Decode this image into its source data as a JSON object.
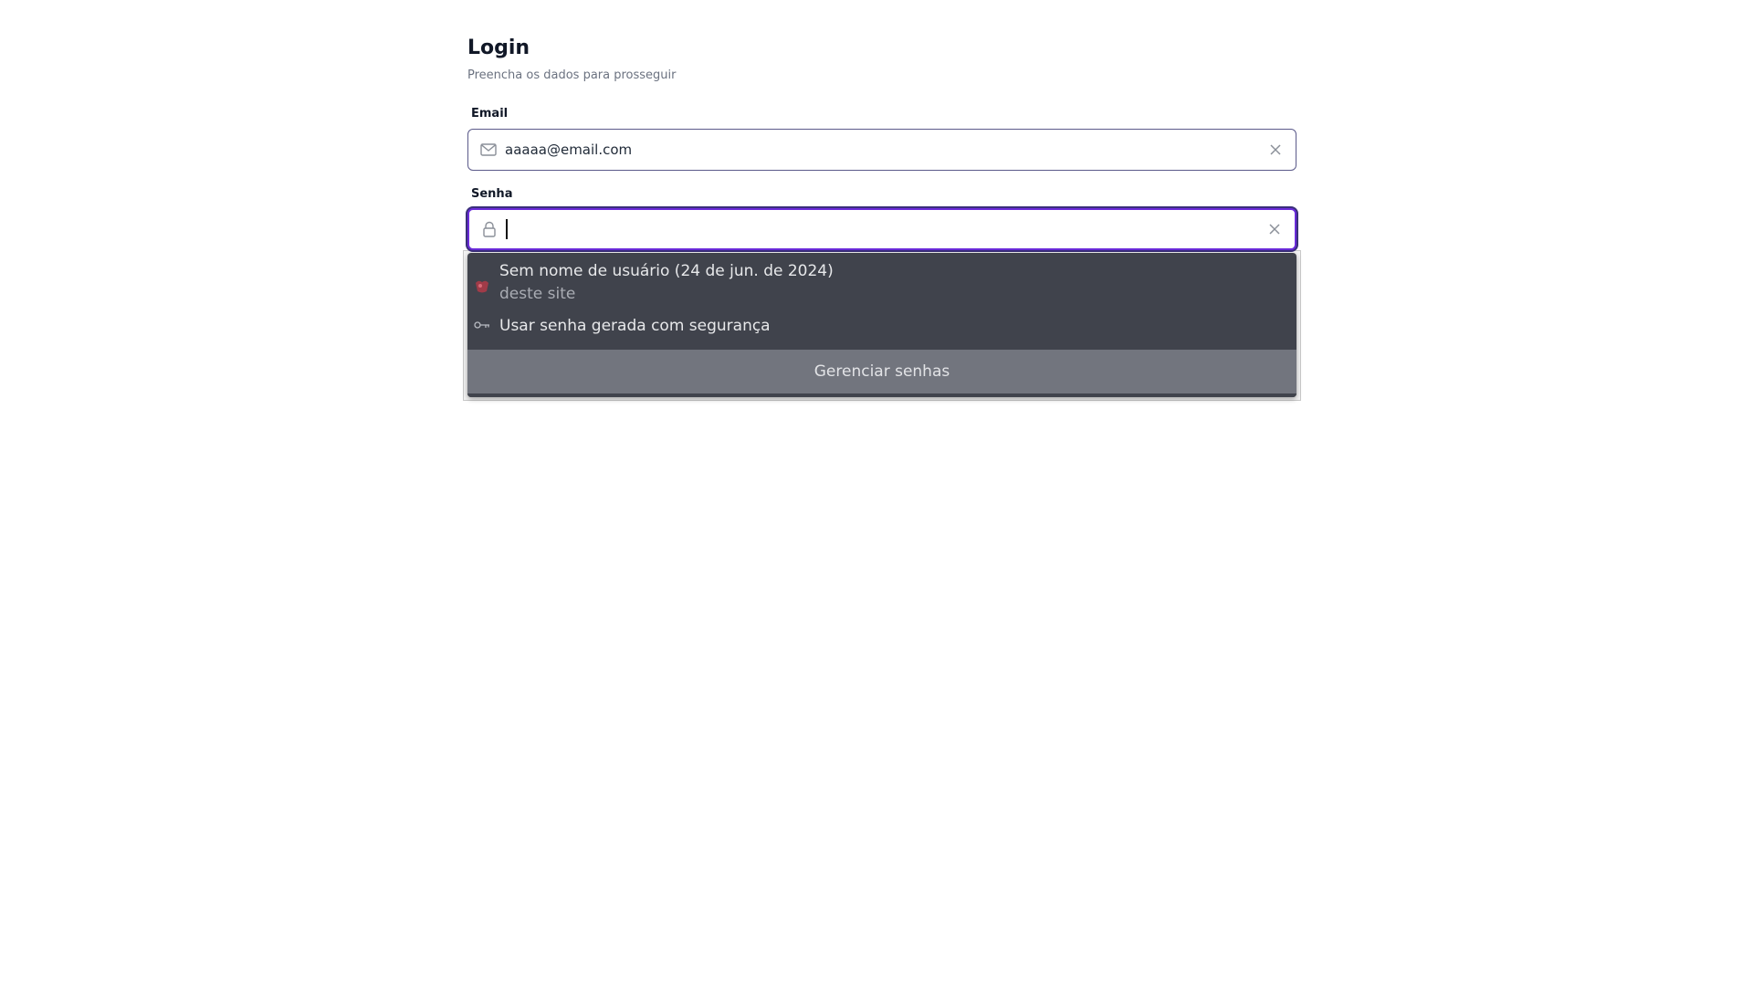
{
  "header": {
    "title": "Login",
    "subtitle": "Preencha os dados para prosseguir"
  },
  "email": {
    "label": "Email",
    "value": "aaaaa@email.com",
    "icon": "mail-icon"
  },
  "password": {
    "label": "Senha",
    "value": "",
    "icon": "lock-icon"
  },
  "autofill": {
    "saved_entry": {
      "title": "Sem nome de usuário (24 de jun. de 2024)",
      "subtitle": "deste site",
      "icon": "saved-password-icon"
    },
    "generate": {
      "label": "Usar senha gerada com segurança",
      "icon": "key-icon"
    },
    "manage_label": "Gerenciar senhas"
  },
  "colors": {
    "focus_border": "#6a2bd9",
    "dropdown_bg": "#40434c",
    "manage_bg": "#72757e"
  }
}
